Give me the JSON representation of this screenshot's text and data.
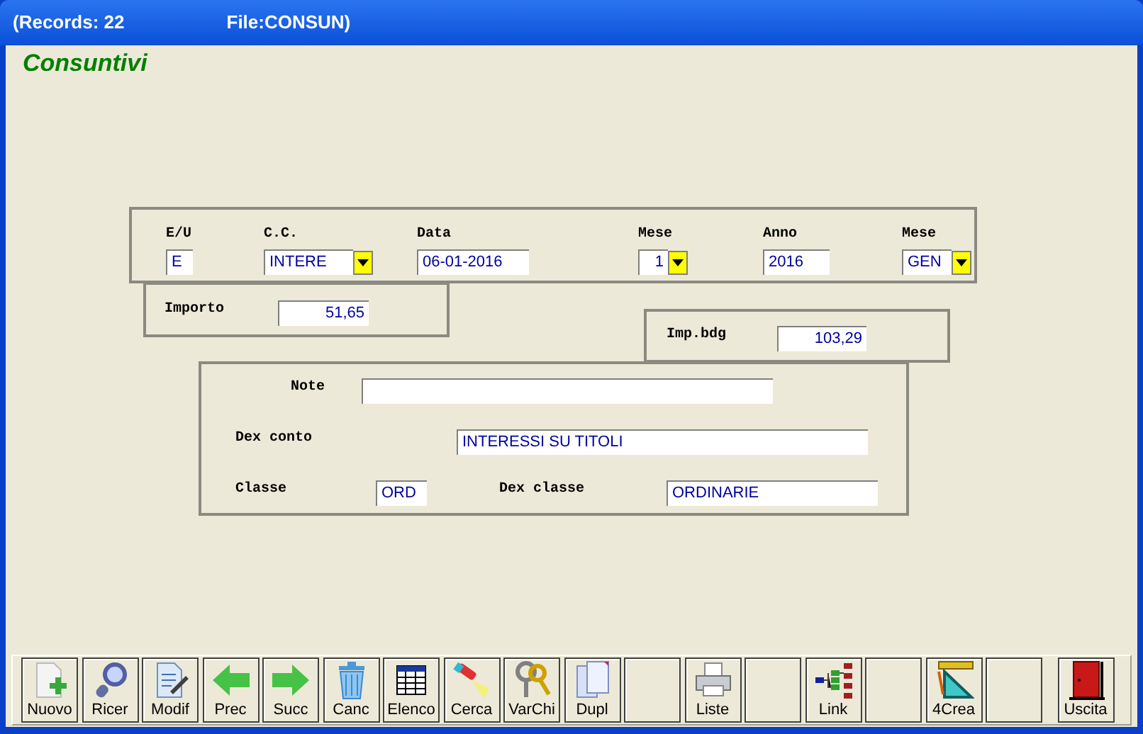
{
  "window": {
    "title_parts": [
      "(Records: 22",
      "File:CONSUN)"
    ]
  },
  "heading": "Consuntivi",
  "panels": [
    {
      "fields": [
        {
          "kind": "text",
          "label": "E/U",
          "value": "E"
        },
        {
          "kind": "combo",
          "label": "C.C.",
          "value": "INTERE"
        },
        {
          "kind": "text",
          "label": "Data",
          "value": "06-01-2016"
        },
        {
          "kind": "numcombo",
          "label": "Mese",
          "value": "1"
        },
        {
          "kind": "text",
          "label": "Anno",
          "value": "2016"
        },
        {
          "kind": "combo",
          "label": "Mese",
          "value": "GEN"
        }
      ]
    },
    {
      "fields": [
        {
          "kind": "number",
          "label": "Importo",
          "value": "51,65"
        }
      ]
    },
    {
      "fields": [
        {
          "kind": "number",
          "label": "Imp.bdg",
          "value": "103,29"
        }
      ]
    },
    {
      "fields": [
        {
          "kind": "text",
          "label": "Note"
        },
        {
          "kind": "text",
          "label": "Dex conto",
          "value": "INTERESSI SU TITOLI"
        },
        {
          "kind": "text",
          "label": "Classe",
          "value": "ORD"
        },
        {
          "kind": "text",
          "label": "Dex classe",
          "value": "ORDINARIE"
        }
      ]
    }
  ],
  "toolbar": [
    {
      "kind": "button",
      "label": "Nuovo"
    },
    {
      "kind": "button",
      "label": "Ricer"
    },
    {
      "kind": "button",
      "label": "Modif"
    },
    {
      "kind": "button",
      "label": "Prec"
    },
    {
      "kind": "button",
      "label": "Succ"
    },
    {
      "kind": "button",
      "label": "Canc"
    },
    {
      "kind": "button",
      "label": "Elenco"
    },
    {
      "kind": "button",
      "label": "Cerca"
    },
    {
      "kind": "button",
      "label": "VarChi"
    },
    {
      "kind": "button",
      "label": "Dupl"
    },
    {
      "kind": "blank"
    },
    {
      "kind": "button",
      "label": "Liste"
    },
    {
      "kind": "blank"
    },
    {
      "kind": "button",
      "label": "Link"
    },
    {
      "kind": "blank"
    },
    {
      "kind": "button",
      "label": "4Crea"
    },
    {
      "kind": "blank"
    },
    {
      "kind": "button",
      "label": "Uscita"
    }
  ]
}
